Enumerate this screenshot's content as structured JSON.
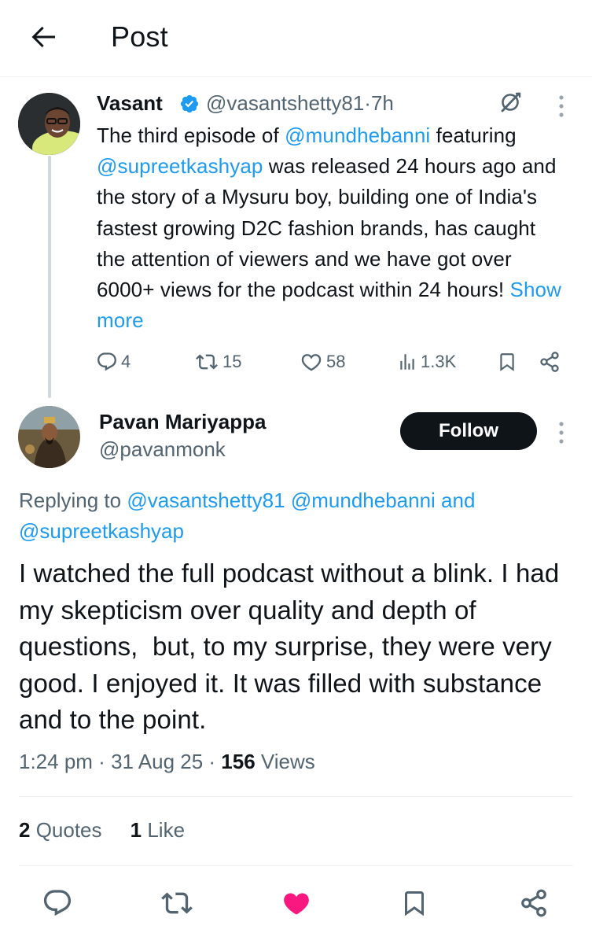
{
  "header": {
    "title": "Post"
  },
  "parent_tweet": {
    "name": "Vasant",
    "handle": "@vasantshetty81",
    "separator": "·",
    "time": "7h",
    "text_parts": [
      {
        "t": "The third episode of ",
        "link": false
      },
      {
        "t": "@mundhebanni",
        "link": true
      },
      {
        "t": " featuring ",
        "link": false
      },
      {
        "t": "@supreetkashyap",
        "link": true
      },
      {
        "t": " was released 24 hours ago and the story of a Mysuru boy, building one of India's fastest growing D2C fashion brands, has caught the attention of viewers and we have got over 6000+ views for the podcast within 24 hours! ",
        "link": false
      },
      {
        "t": "Show more",
        "link": true
      }
    ],
    "stats": {
      "replies": "4",
      "reposts": "15",
      "likes": "58",
      "views": "1.3K"
    }
  },
  "reply_tweet": {
    "name": "Pavan Mariyappa",
    "handle": "@pavanmonk",
    "follow_label": "Follow",
    "replying_prefix": "Replying to ",
    "replying_to": [
      "@vasantshetty81",
      "@mundhebanni",
      "@supreetkashyap"
    ],
    "replying_and": " and",
    "text": "I watched the full podcast without a blink. I had my skepticism over quality and depth of questions,  but, to my surprise, they were very good. I enjoyed it. It was filled with substance and to the point.",
    "time": "1:24 pm",
    "date": "31 Aug 25",
    "separator": " · ",
    "views_count": "156",
    "views_label": " Views",
    "quotes_count": "2",
    "quotes_label": " Quotes",
    "likes_count": "1",
    "likes_label": " Like"
  },
  "colors": {
    "link": "#1d9bf0",
    "secondary": "#536471",
    "like_active": "#f91880",
    "verified": "#1d9bf0",
    "text": "#0f1419"
  },
  "icons": [
    "back-arrow-icon",
    "verified-badge-icon",
    "grok-icon",
    "more-icon",
    "reply-icon",
    "repost-icon",
    "like-icon",
    "views-icon",
    "bookmark-icon",
    "share-icon"
  ]
}
